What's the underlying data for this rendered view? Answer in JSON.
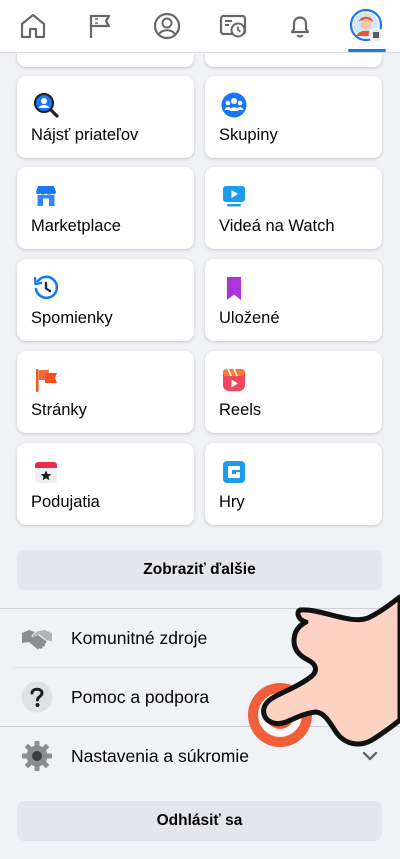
{
  "nav": {
    "items": [
      {
        "icon": "home-icon"
      },
      {
        "icon": "flag-icon"
      },
      {
        "icon": "profile-icon"
      },
      {
        "icon": "memories-feed-icon"
      },
      {
        "icon": "bell-icon"
      },
      {
        "icon": "avatar-menu-icon",
        "active": true
      }
    ]
  },
  "shortcuts": [
    {
      "label": "Nájsť priateľov",
      "icon": "find-friends-icon"
    },
    {
      "label": "Skupiny",
      "icon": "groups-icon"
    },
    {
      "label": "Marketplace",
      "icon": "marketplace-icon"
    },
    {
      "label": "Videá na Watch",
      "icon": "watch-icon"
    },
    {
      "label": "Spomienky",
      "icon": "memories-icon"
    },
    {
      "label": "Uložené",
      "icon": "saved-icon"
    },
    {
      "label": "Stránky",
      "icon": "pages-icon"
    },
    {
      "label": "Reels",
      "icon": "reels-icon"
    },
    {
      "label": "Podujatia",
      "icon": "events-icon"
    },
    {
      "label": "Hry",
      "icon": "games-icon"
    }
  ],
  "see_more_label": "Zobraziť ďalšie",
  "menu_rows": [
    {
      "label": "Komunitné zdroje",
      "icon": "handshake-icon"
    },
    {
      "label": "Pomoc a podpora",
      "icon": "help-icon"
    },
    {
      "label": "Nastavenia a súkromie",
      "icon": "settings-gear-icon",
      "expandable": true
    }
  ],
  "logout_label": "Odhlásiť sa",
  "colors": {
    "accent": "#1877f2",
    "background": "#f0f2f5",
    "button": "#e4e6eb",
    "hand": "#fbd2c3",
    "tap_indicator": "#f0562f"
  }
}
